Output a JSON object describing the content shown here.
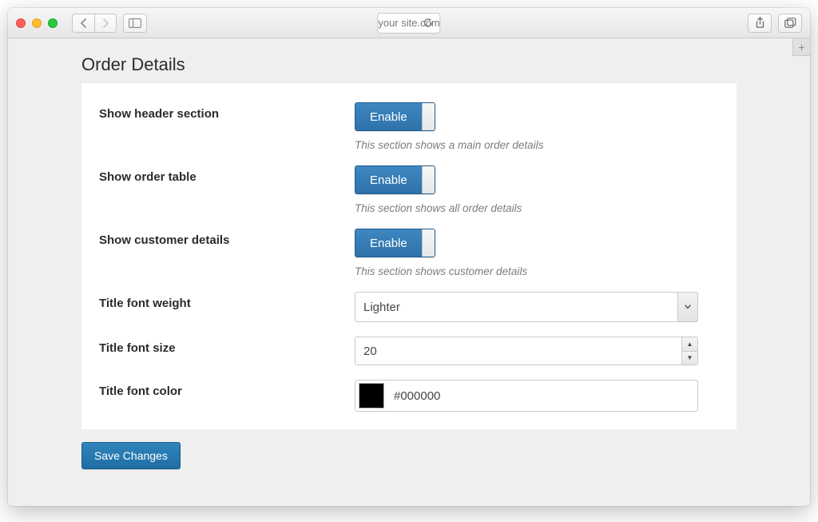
{
  "browser": {
    "url": "your site.com"
  },
  "page": {
    "title": "Order Details",
    "save_label": "Save Changes"
  },
  "settings": {
    "header_section": {
      "label": "Show header section",
      "toggle": "Enable",
      "help": "This section shows a main order details"
    },
    "order_table": {
      "label": "Show order table",
      "toggle": "Enable",
      "help": "This section shows all order details"
    },
    "customer_details": {
      "label": "Show customer details",
      "toggle": "Enable",
      "help": "This section shows customer details"
    },
    "title_font_weight": {
      "label": "Title font weight",
      "value": "Lighter"
    },
    "title_font_size": {
      "label": "Title font size",
      "value": "20"
    },
    "title_font_color": {
      "label": "Title font color",
      "value": "#000000",
      "swatch": "#000000"
    }
  }
}
